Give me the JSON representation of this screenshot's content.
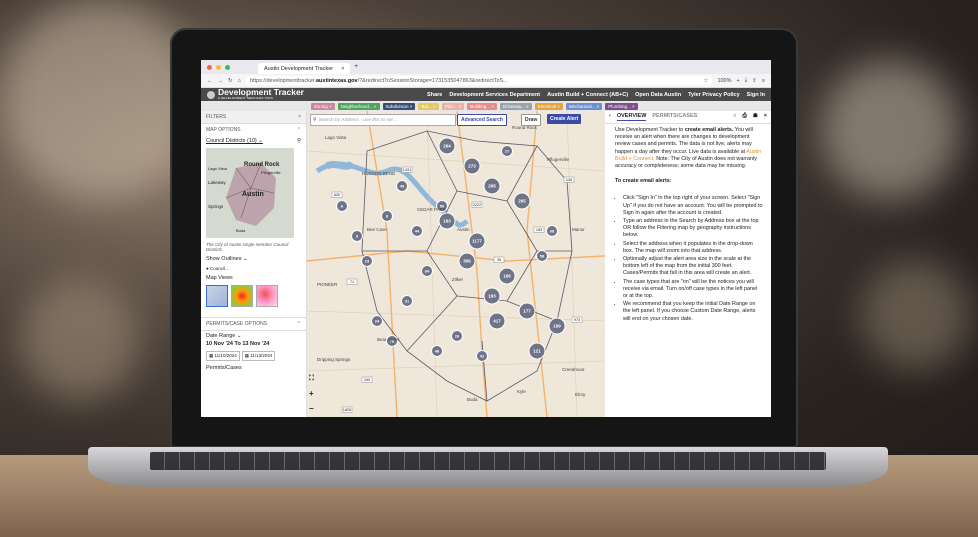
{
  "browser": {
    "tab_title": "Austin Development Tracker",
    "tab_close": "×",
    "new_tab": "+",
    "url_prefix": "https://developmenttracker.",
    "url_domain": "austintexas.gov",
    "url_rest": "/?&redirectToSessionStorage=1731535047863&redirectToS...",
    "zoom": "100%"
  },
  "navbar": {
    "title": "Development Tracker",
    "subtitle": "A DEVELOPMENT SERVICES TOOL",
    "links": [
      "Share",
      "Development Services Department",
      "Austin Build + Connect (AB+C)",
      "Open Data Austin",
      "Tyler Privacy Policy",
      "Sign In"
    ]
  },
  "chips": [
    {
      "label": "Zoning ×",
      "color": "#c9889c"
    },
    {
      "label": "Neighborhood... ×",
      "color": "#4fa35a"
    },
    {
      "label": "Subdivision ×",
      "color": "#3a4d74"
    },
    {
      "label": "Bui... ×",
      "color": "#e6c766"
    },
    {
      "label": "Plan... ×",
      "color": "#e8b3a6"
    },
    {
      "label": "Building... ×",
      "color": "#e58b8b"
    },
    {
      "label": "Driveway... ×",
      "color": "#9aa3ad"
    },
    {
      "label": "Electrical ×",
      "color": "#e7a43c"
    },
    {
      "label": "Mechanical... ×",
      "color": "#6d8fc9"
    },
    {
      "label": "Plumbing... ×",
      "color": "#7a4e8f"
    }
  ],
  "left": {
    "filters_label": "FILTERS",
    "close": "×",
    "map_options": "MAP OPTIONS",
    "council_districts": "Council Districts (10) ⌄",
    "minimap_labels": [
      "Round Rock",
      "Pflugerville",
      "Lago Vista",
      "Lakeway",
      "Austin",
      "Springs",
      "Buda"
    ],
    "caption": "The City of Austin single member Council Districts",
    "show_outlines": "Show Outlines ⌄",
    "council_bullet": "● Council...",
    "map_views": "Map Views",
    "permits_options": "PERMITS/CASE OPTIONS",
    "date_range_label": "Date Range ⌄",
    "date_range_value": "10 Nov '24 To 13 Nov '24",
    "date_from": "11/10/2024",
    "date_to": "11/13/2024",
    "permits_cases": "Permits/Cases"
  },
  "map": {
    "search_placeholder": "Search by Address - use this to set ...",
    "advanced_search": "Advanced Search",
    "draw": "Draw",
    "create_alert": "Create Alert",
    "place_labels": [
      "Lago Vista",
      "HUDSON BEND",
      "Round Rock",
      "Pflugerville",
      "Manor",
      "Bee Cave",
      "Austin",
      "Bear Creek",
      "Buda",
      "Kyle",
      "Creedmoor",
      "Elroy",
      "PIONEER",
      "CEDAR PARK",
      "Dripping Springs",
      "Zilker"
    ],
    "road_labels": [
      "45",
      "71",
      "290",
      "1826",
      "130",
      "2222",
      "35",
      "183",
      "620",
      "1431",
      "973",
      "21"
    ],
    "clusters": [
      {
        "label": "264"
      },
      {
        "label": "273"
      },
      {
        "label": "295"
      },
      {
        "label": "265"
      },
      {
        "label": "163"
      },
      {
        "label": "1177"
      },
      {
        "label": "306"
      },
      {
        "label": "186"
      },
      {
        "label": "183"
      },
      {
        "label": "177"
      },
      {
        "label": "417"
      },
      {
        "label": "199"
      },
      {
        "label": "49"
      },
      {
        "label": "44"
      },
      {
        "label": "50"
      },
      {
        "label": "84"
      },
      {
        "label": "31"
      },
      {
        "label": "24"
      },
      {
        "label": "76"
      },
      {
        "label": "6"
      },
      {
        "label": "9"
      },
      {
        "label": "8"
      },
      {
        "label": "26"
      },
      {
        "label": "48"
      },
      {
        "label": "58"
      },
      {
        "label": "68"
      },
      {
        "label": "42"
      },
      {
        "label": "121"
      },
      {
        "label": "17"
      },
      {
        "label": "23"
      }
    ],
    "zoom_in": "+",
    "zoom_out": "−"
  },
  "right": {
    "tab_overview": "OVERVIEW",
    "tab_permits": "PERMITS/CASES",
    "intro_1": "Use Development Tracker to ",
    "intro_bold": "create email alerts.",
    "intro_2": " You will receive an alert when there are changes to development review cases and permits. The data is not live; alerts may happen a day after they occur. Live data is available at ",
    "intro_link": "Austin Build + Connect.",
    "intro_3": " Note: The City of Austin does not warranty accuracy or completeness; some data may be missing.",
    "how_to": "To create email alerts:",
    "bullets": [
      "Click \"Sign In\" in the top right of your screen. Select \"Sign Up\" if you do not have an account. You will be prompted to Sign In again after the account is created.",
      "Type an address in the Search by Address box at the top OR follow the Filtering map by geography instructions below.",
      "Select the address when it populates in the drop-down box. The map will zoom into that address.",
      "Optionally adjust the alert area size in the scale at the bottom left of the map from the initial 300 feet. Cases/Permits that fall in this area will create an alert.",
      "The case types that are \"on\" will be the notices you will receive via email. Turn on/off case types in the left panel or at the top.",
      "We recommend that you keep the initial Date Range on the left panel. If you choose Custom Date Range, alerts will end on your chosen date."
    ]
  },
  "colors": {
    "navbar": "#4a4a4a",
    "cluster": "#6f7488",
    "accent": "#3b4aa8",
    "link": "#e98b29"
  }
}
